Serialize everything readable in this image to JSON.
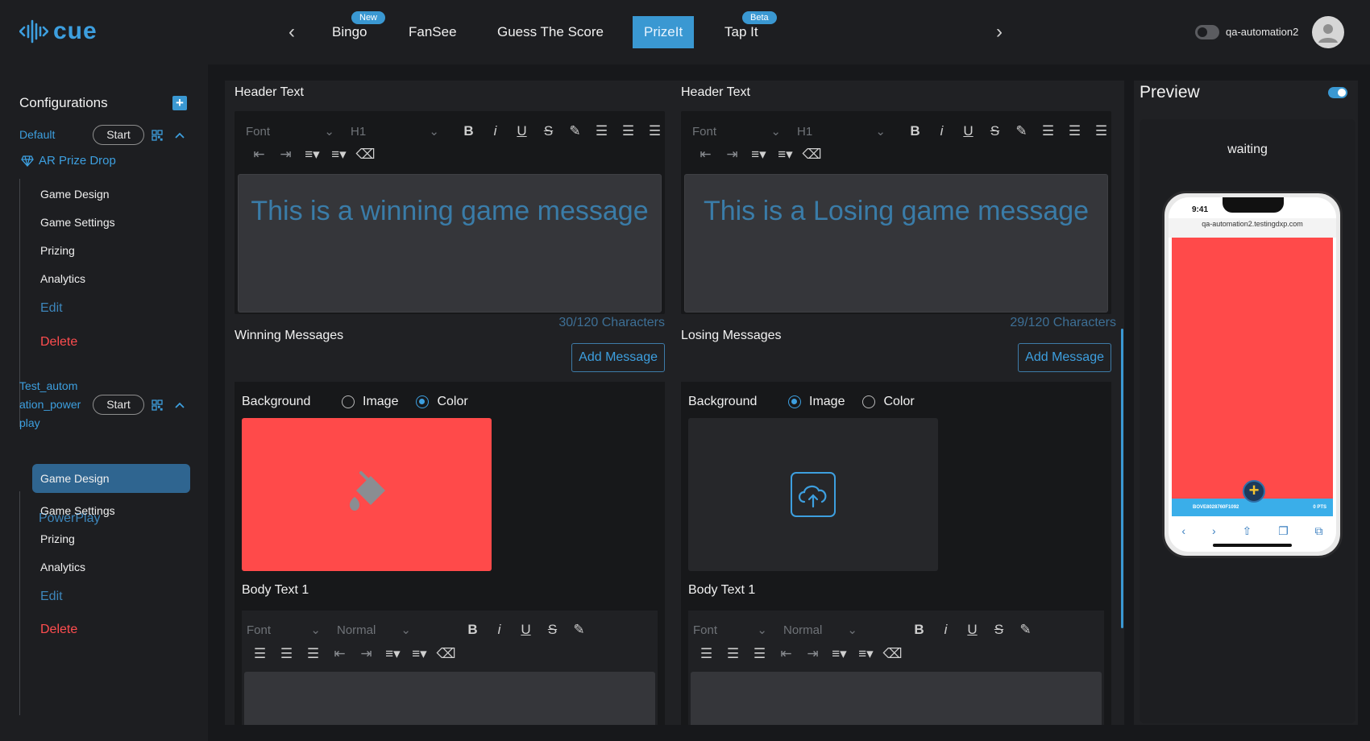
{
  "app": {
    "logo_text": "cue"
  },
  "nav": {
    "tabs": [
      {
        "label": "Bingo",
        "tag": "New"
      },
      {
        "label": "FanSee"
      },
      {
        "label": "Guess The Score"
      },
      {
        "label": "PrizeIt",
        "active": true
      },
      {
        "label": "Tap It",
        "tag": "Beta"
      }
    ]
  },
  "user": {
    "name": "qa-automation2"
  },
  "sidebar": {
    "title": "Configurations",
    "groups": [
      {
        "name": "Default",
        "start_label": "Start",
        "prize_label": "AR Prize Drop",
        "items": [
          "Game Design",
          "Game Settings",
          "Prizing",
          "Analytics"
        ],
        "edit_label": "Edit",
        "delete_label": "Delete"
      },
      {
        "name_lines": [
          "Test_autom",
          "ation_power",
          "play"
        ],
        "start_label": "Start",
        "prize_label": "PowerPlay",
        "items": [
          "Game Design",
          "Game Settings",
          "Prizing",
          "Analytics"
        ],
        "edit_label": "Edit",
        "delete_label": "Delete"
      }
    ]
  },
  "editor": {
    "font_placeholder": "Font",
    "heading_value": "H1",
    "body_style_value": "Normal",
    "left": {
      "header_label": "Header Text",
      "message": "This is a winning game message",
      "char_count": "30/120 Characters",
      "section_label": "Winning Messages",
      "add_label": "Add Message",
      "background_label": "Background",
      "image_label": "Image",
      "color_label": "Color",
      "selected": "Color",
      "swatch_color": "#ff4a4a",
      "body_label": "Body Text 1"
    },
    "right": {
      "header_label": "Header Text",
      "message": "This is a Losing game message",
      "char_count": "29/120 Characters",
      "section_label": "Losing Messages",
      "add_label": "Add Message",
      "background_label": "Background",
      "image_label": "Image",
      "color_label": "Color",
      "selected": "Image",
      "body_label": "Body Text 1"
    }
  },
  "preview": {
    "title": "Preview",
    "status": "waiting",
    "phone": {
      "time": "9:41",
      "url": "qa-automation2.testingdxp.com",
      "code": "BOVE8028760F1092",
      "pts": "0 PTS"
    }
  },
  "colors": {
    "accent": "#3a98d2",
    "danger": "#ff4d4f",
    "swatch_red": "#ff4a4a"
  }
}
